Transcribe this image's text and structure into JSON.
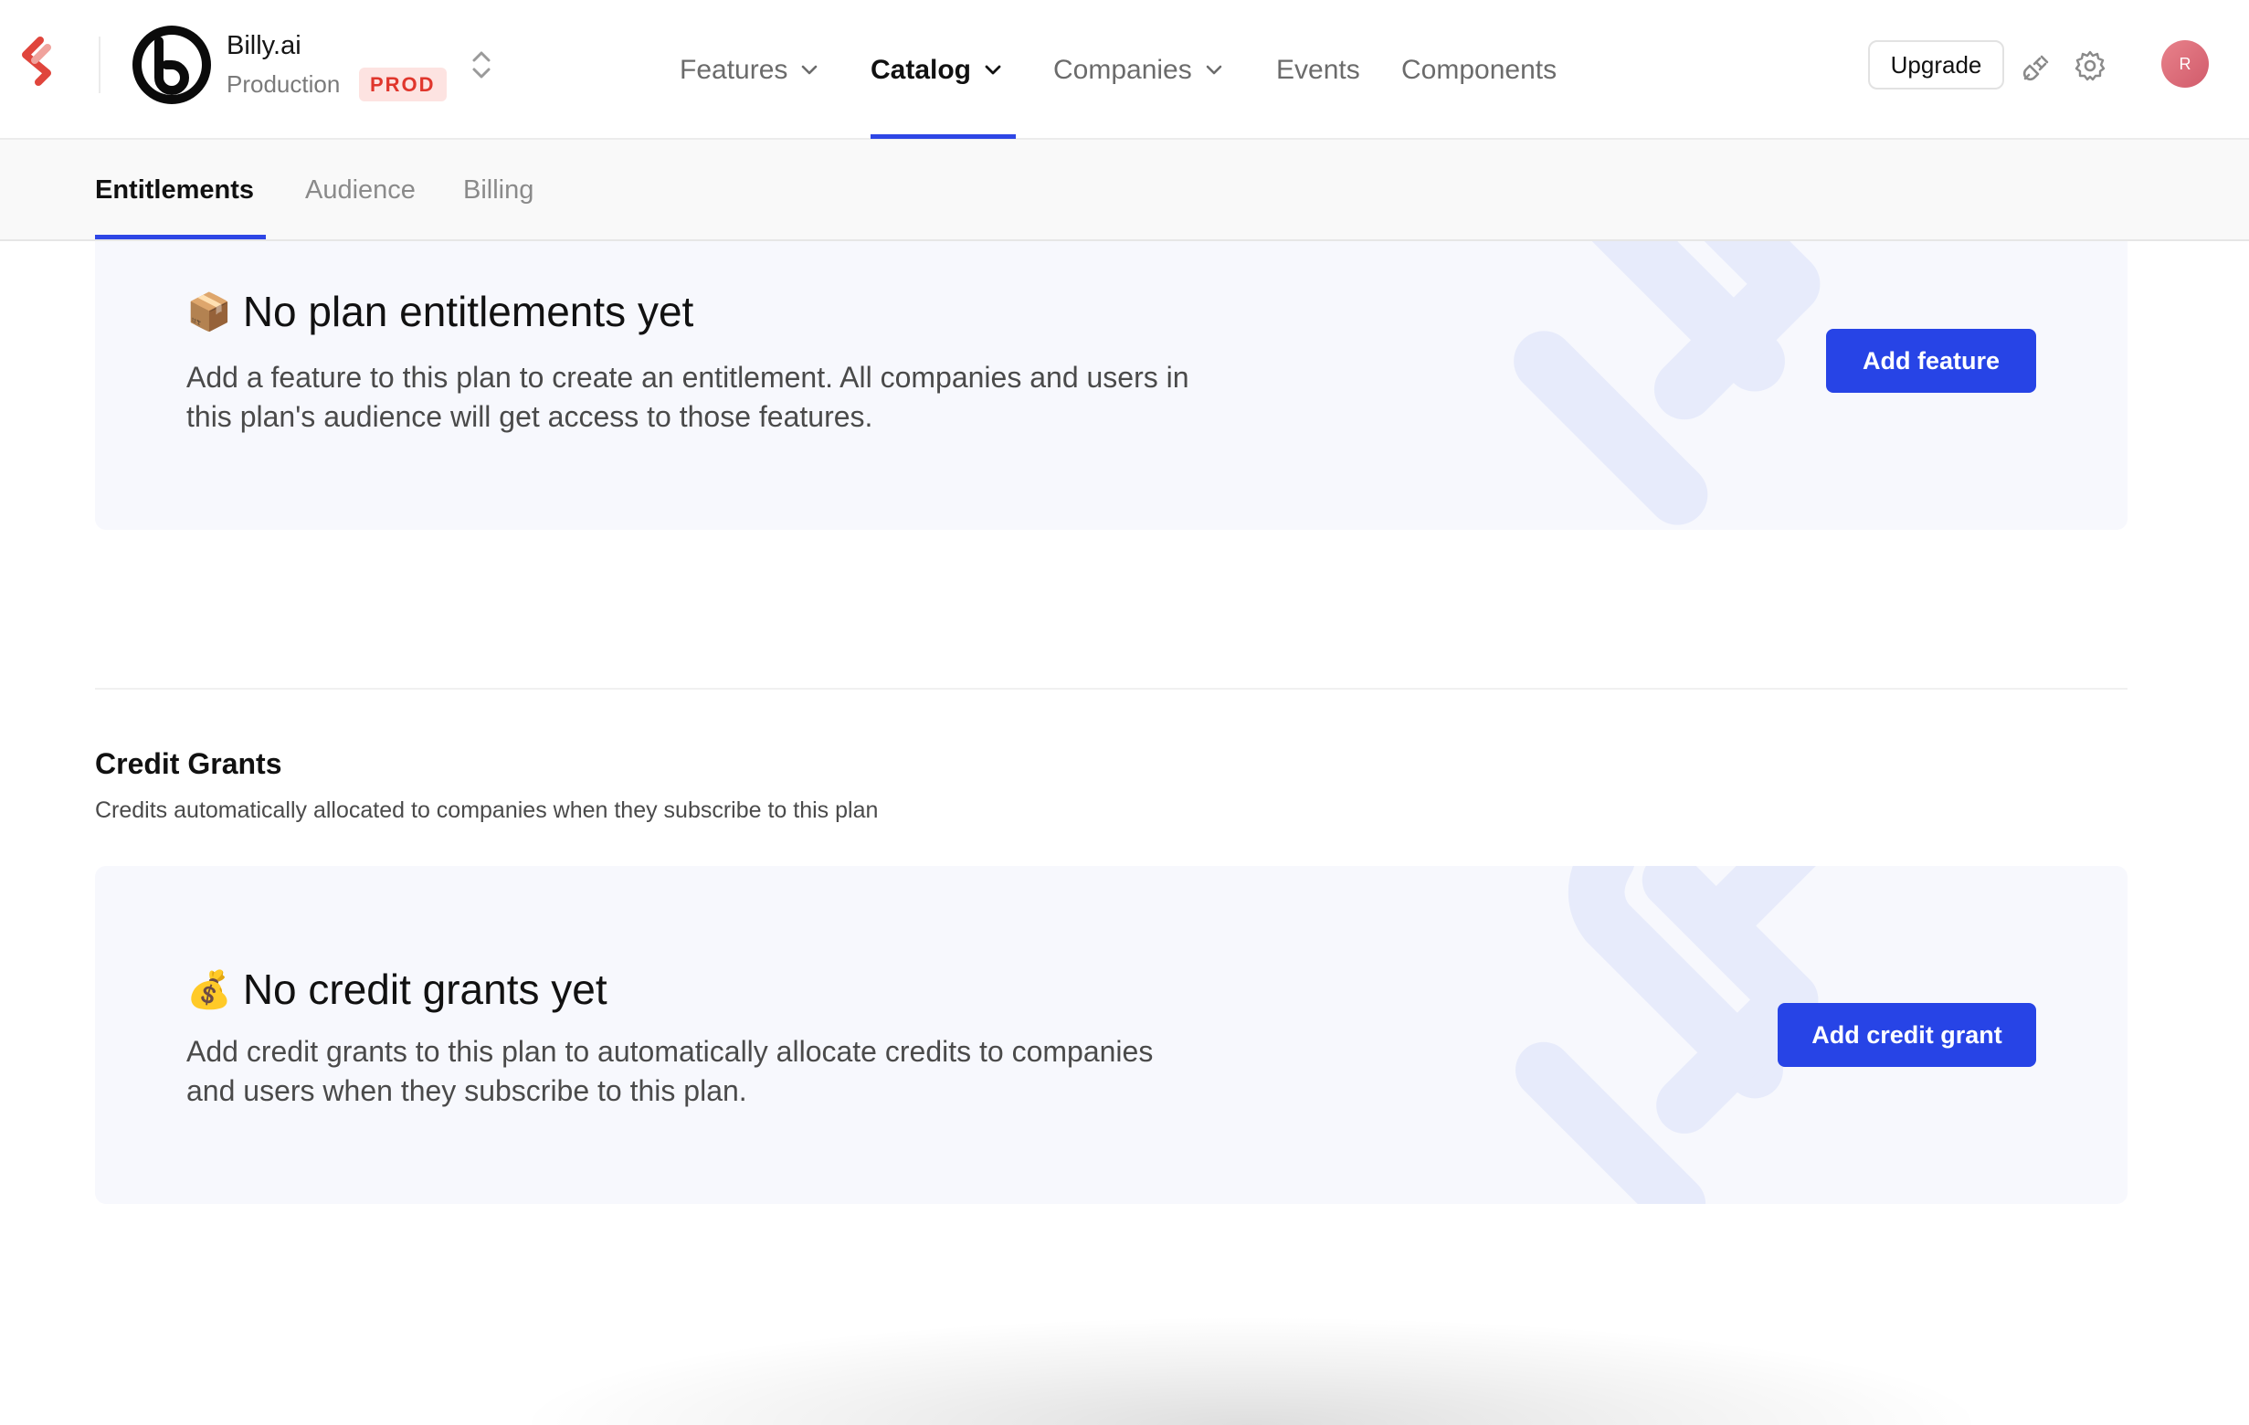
{
  "header": {
    "org": {
      "name": "Billy.ai",
      "environment": "Production",
      "env_badge": "PROD"
    },
    "nav": [
      {
        "label": "Features",
        "has_dropdown": true,
        "active": false
      },
      {
        "label": "Catalog",
        "has_dropdown": true,
        "active": true
      },
      {
        "label": "Companies",
        "has_dropdown": true,
        "active": false
      },
      {
        "label": "Events",
        "has_dropdown": false,
        "active": false
      },
      {
        "label": "Components",
        "has_dropdown": false,
        "active": false
      }
    ],
    "upgrade_label": "Upgrade",
    "user_initial": "R",
    "icons": [
      "schematic-logo-icon",
      "chevron-up-down-icon",
      "plug-icon",
      "gear-icon"
    ],
    "accent_color": "#2e46e5",
    "brand_color": "#e0453c"
  },
  "subtabs": [
    {
      "label": "Entitlements",
      "active": true
    },
    {
      "label": "Audience",
      "active": false
    },
    {
      "label": "Billing",
      "active": false
    }
  ],
  "entitlements_empty": {
    "emoji": "📦",
    "title": "No plan entitlements yet",
    "description": "Add a feature to this plan to create an entitlement. All companies and users in this plan's audience will get access to those features.",
    "button_label": "Add feature"
  },
  "credit_grants": {
    "title": "Credit Grants",
    "description": "Credits automatically allocated to companies when they subscribe to this plan",
    "empty": {
      "emoji": "💰",
      "title": "No credit grants yet",
      "description": "Add credit grants to this plan to automatically allocate credits to companies and users when they subscribe to this plan.",
      "button_label": "Add credit grant"
    }
  }
}
